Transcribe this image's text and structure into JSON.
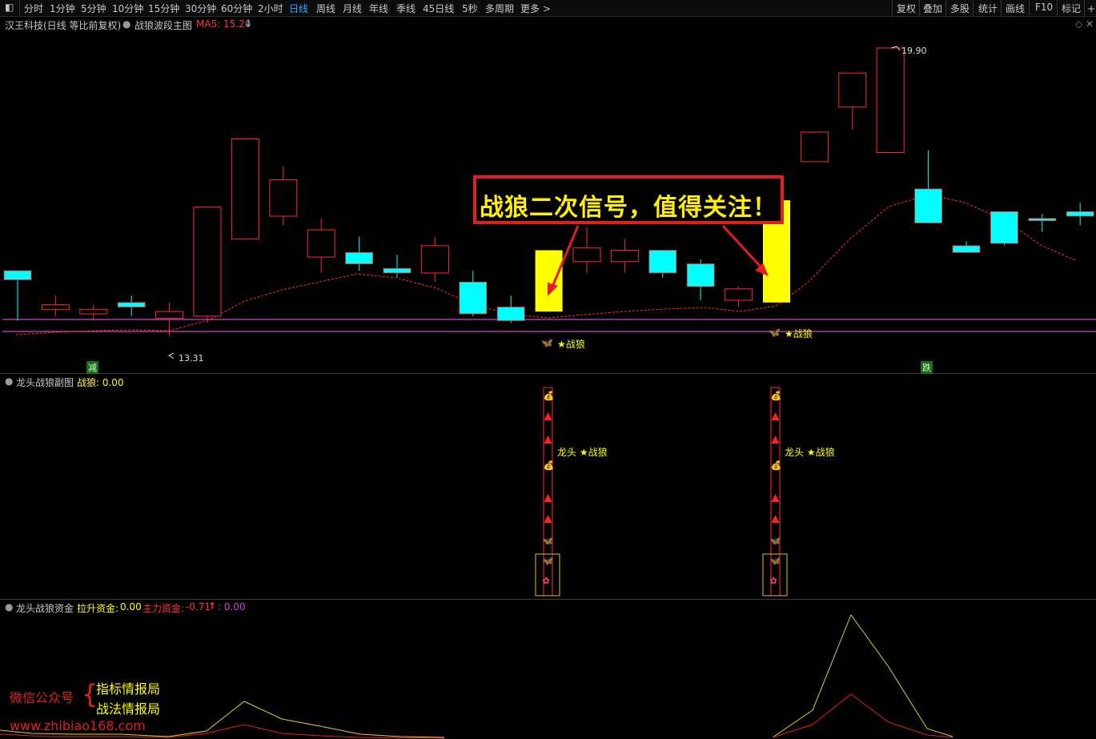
{
  "toolbar": {
    "periods": [
      "分时",
      "1分钟",
      "5分钟",
      "10分钟",
      "15分钟",
      "30分钟",
      "60分钟",
      "2小时",
      "日线",
      "周线",
      "月线",
      "年线",
      "季线",
      "45日线",
      "5秒",
      "多周期",
      "更多 >"
    ],
    "active_period": "日线",
    "right_buttons": [
      "复权",
      "叠加",
      "多股",
      "统计",
      "画线",
      "F10",
      "标记",
      "+自"
    ]
  },
  "main_panel": {
    "stock_title": "汉王科技(日线 等比前复权)",
    "indicator_name": "战狼波段主图",
    "ma_label": "MA5: 15.20",
    "ma_arrow": "↓",
    "high_marker": "19.90",
    "low_marker": "13.31",
    "signal_label": "★战狼",
    "signal_icon": "butterfly-icon",
    "callout_text": "战狼二次信号，值得关注！",
    "left_tag": "减",
    "right_tag": "跌",
    "colors": {
      "up": "#ff2a2a",
      "down": "#00ffff",
      "signal": "#ffff00",
      "ma": "#ff3030",
      "support": "#cc44cc"
    }
  },
  "sub_panel": {
    "name": "龙头战狼副图",
    "value_label": "战狼: 0.00",
    "signal_text": "龙头 ★战狼"
  },
  "fund_panel": {
    "name": "龙头战狼资金",
    "lift_label": "拉升资金:",
    "lift_value": "0.00",
    "main_label": "主力资金:",
    "main_value": "-0.71",
    "main_arrow": "↑",
    "third_label": ": 0.00"
  },
  "watermark": {
    "wechat": "微信公众号",
    "brace": "{",
    "account1": "指标情报局",
    "account2": "战法情报局",
    "url": "www.zhibiao168.com"
  },
  "chart_data": {
    "type": "candlestick",
    "series": [
      {
        "name": "K",
        "ohlc": [
          [
            15.0,
            15.0,
            13.9,
            14.8
          ],
          [
            14.15,
            14.45,
            14.0,
            14.25
          ],
          [
            14.05,
            14.25,
            13.9,
            14.15
          ],
          [
            14.3,
            14.45,
            14.0,
            14.2
          ],
          [
            13.95,
            14.3,
            13.55,
            14.1
          ],
          [
            14.0,
            16.4,
            13.85,
            16.4
          ],
          [
            15.7,
            17.9,
            15.7,
            17.9
          ],
          [
            16.2,
            17.3,
            16.0,
            17.0
          ],
          [
            15.3,
            16.15,
            14.95,
            15.9
          ],
          [
            15.4,
            15.75,
            15.0,
            15.15
          ],
          [
            15.05,
            15.35,
            14.85,
            14.95
          ],
          [
            14.95,
            15.75,
            14.75,
            15.55
          ],
          [
            14.75,
            15.0,
            14.0,
            14.05
          ],
          [
            14.2,
            14.45,
            13.85,
            13.9
          ],
          [
            14.1,
            15.45,
            14.1,
            15.45
          ],
          [
            15.2,
            15.95,
            14.95,
            15.5
          ],
          [
            15.2,
            15.7,
            14.95,
            15.45
          ],
          [
            15.45,
            15.45,
            14.85,
            14.95
          ],
          [
            15.15,
            15.25,
            14.35,
            14.65
          ],
          [
            14.35,
            14.65,
            14.2,
            14.6
          ],
          [
            14.3,
            16.55,
            14.3,
            16.55
          ],
          [
            17.4,
            17.4,
            17.4,
            18.05
          ],
          [
            18.6,
            19.35,
            18.1,
            19.35
          ],
          [
            17.6,
            19.9,
            17.6,
            19.9
          ],
          [
            16.8,
            17.65,
            16.8,
            16.05
          ],
          [
            15.55,
            15.65,
            15.55,
            15.4
          ],
          [
            16.3,
            16.3,
            15.55,
            15.6
          ],
          [
            16.15,
            16.25,
            15.85,
            16.1
          ],
          [
            16.3,
            16.5,
            16.0,
            16.2
          ]
        ]
      }
    ],
    "signals_at": [
      14,
      20
    ]
  }
}
